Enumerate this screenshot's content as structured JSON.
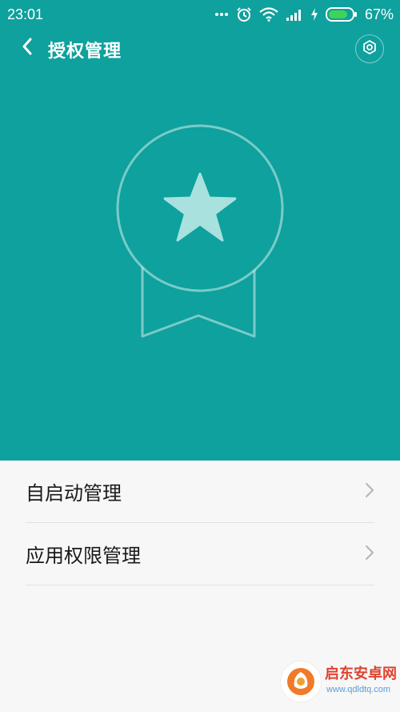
{
  "status_bar": {
    "time": "23:01",
    "icons": [
      "dots-icon",
      "alarm-icon",
      "wifi-icon",
      "signal-icon",
      "charging-icon",
      "battery-icon"
    ],
    "battery_percent": "67%"
  },
  "app_bar": {
    "title": "授权管理",
    "back_icon": "chevron-left-icon",
    "settings_icon": "gear-icon"
  },
  "hero": {
    "illustration": "award-badge-star-icon"
  },
  "list": {
    "items": [
      {
        "label": "自启动管理",
        "icon": "chevron-right-icon"
      },
      {
        "label": "应用权限管理",
        "icon": "chevron-right-icon"
      }
    ]
  },
  "watermark": {
    "name": "启东安卓网",
    "url": "www.qdldtq.com"
  },
  "colors": {
    "primary": "#0ea19d",
    "background": "#f7f7f7",
    "divider": "#e2e2e2",
    "text": "#1a1a1a",
    "chevron": "#b5b5b5",
    "battery_fill": "#3fd35a"
  }
}
